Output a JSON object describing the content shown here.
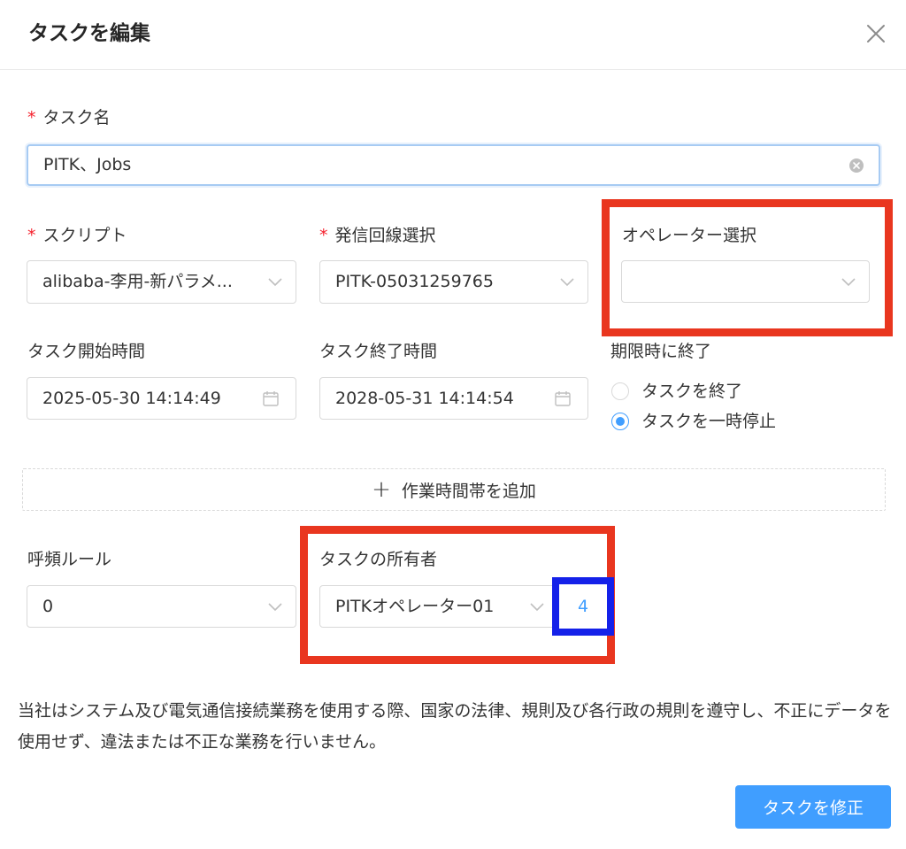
{
  "dialog": {
    "title": "タスクを編集"
  },
  "form": {
    "task_name": {
      "label": "タスク名",
      "required_mark": "*",
      "value": "PITK、Jobs"
    },
    "script": {
      "label": "スクリプト",
      "required_mark": "*",
      "value": "alibaba-李用-新パラメ..."
    },
    "line_select": {
      "label": "発信回線選択",
      "required_mark": "*",
      "value": "PITK-05031259765"
    },
    "operator_select": {
      "label": "オペレーター選択",
      "value": ""
    },
    "start_time": {
      "label": "タスク開始時間",
      "value": "2025-05-30 14:14:49"
    },
    "end_time": {
      "label": "タスク終了時間",
      "value": "2028-05-31 14:14:54"
    },
    "on_expire": {
      "label": "期限時に終了",
      "options": [
        {
          "label": "タスクを終了",
          "checked": false
        },
        {
          "label": "タスクを一時停止",
          "checked": true
        }
      ]
    },
    "add_work_period": {
      "label": "作業時間帯を追加"
    },
    "call_frequency": {
      "label": "呼頻ルール",
      "value": "0"
    },
    "task_owner": {
      "label": "タスクの所有者",
      "value": "PITKオペレーター01",
      "count": "4"
    }
  },
  "notice": "当社はシステム及び電気通信接続業務を使用する際、国家の法律、規則及び各行政の規則を遵守し、不正にデータを使用せず、違法または不正な業務を行いません。",
  "submit": {
    "label": "タスクを修正"
  },
  "colors": {
    "primary": "#409eff",
    "required": "#f5222d",
    "highlight_red": "#e9361f",
    "highlight_blue": "#1421e9"
  },
  "icons": [
    "close-icon",
    "clear-icon",
    "chevron-down-icon",
    "calendar-icon",
    "plus-icon"
  ]
}
